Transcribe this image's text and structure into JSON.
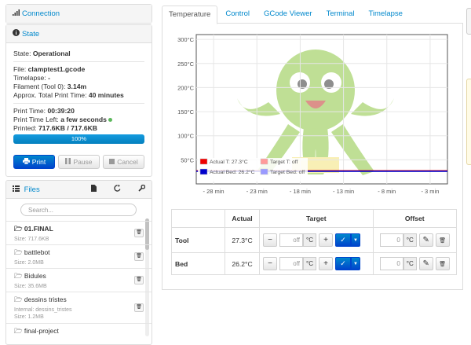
{
  "sidebar": {
    "connection": {
      "label": "Connection"
    },
    "state": {
      "label": "State",
      "state_label": "State:",
      "state_value": "Operational",
      "file_label": "File:",
      "file_value": "clamptest1.gcode",
      "timelapse_label": "Timelapse:",
      "timelapse_value": "-",
      "filament_label": "Filament (Tool 0):",
      "filament_value": "3.14m",
      "approx_label": "Approx. Total Print Time:",
      "approx_value": "40 minutes",
      "print_time_label": "Print Time:",
      "print_time_value": "00:39:20",
      "time_left_label": "Print Time Left:",
      "time_left_value": "a few seconds",
      "printed_label": "Printed:",
      "printed_value": "717.6KB / 717.6KB",
      "progress_text": "100%",
      "progress_fraction": 1.0,
      "buttons": {
        "print": "Print",
        "pause": "Pause",
        "cancel": "Cancel"
      }
    },
    "files": {
      "label": "Files",
      "search_placeholder": "Search...",
      "items": [
        {
          "name": "01.FINAL",
          "size": "Size: 717.6KB",
          "bold": true
        },
        {
          "name": "battlebot",
          "size": "Size: 2.0MB"
        },
        {
          "name": "Bidules",
          "size": "Size: 35.6MB"
        },
        {
          "name": "dessins tristes",
          "internal": "Internal: dessins_tristes",
          "size": "Size: 1.2MB"
        },
        {
          "name": "final-project",
          "size": ""
        }
      ]
    }
  },
  "tabs": [
    "Temperature",
    "Control",
    "GCode Viewer",
    "Terminal",
    "Timelapse"
  ],
  "chart_data": {
    "type": "line",
    "x_ticks": [
      "- 28 min",
      "- 23 min",
      "- 18 min",
      "- 13 min",
      "- 8 min",
      "- 3 min"
    ],
    "x_tick_minutes": [
      -28,
      -23,
      -18,
      -13,
      -8,
      -3
    ],
    "xlim_minutes": [
      -30,
      -1
    ],
    "y_ticks": [
      "300°C",
      "250°C",
      "200°C",
      "150°C",
      "100°C",
      "50°C"
    ],
    "y_tick_values": [
      300,
      250,
      200,
      150,
      100,
      50
    ],
    "ylim": [
      0,
      310
    ],
    "grid": true,
    "legend_position": "bottom-left",
    "series": [
      {
        "name": "Actual T: 27.3°C",
        "color": "#ee0000",
        "x": [
          -30,
          -1
        ],
        "values": [
          27.3,
          27.3
        ]
      },
      {
        "name": "Target T: off",
        "color": "#ff9a9a",
        "x": [],
        "values": []
      },
      {
        "name": "Actual Bed: 26.2°C",
        "color": "#0000cc",
        "x": [
          -30,
          -1
        ],
        "values": [
          26.2,
          26.2
        ]
      },
      {
        "name": "Target Bed: off",
        "color": "#9a9aff",
        "x": [],
        "values": []
      }
    ]
  },
  "temp_table": {
    "headers": [
      "",
      "Actual",
      "Target",
      "Offset"
    ],
    "rows": [
      {
        "label": "Tool",
        "actual": "27.3°C",
        "target_placeholder": "off",
        "offset_value": "0",
        "unit": "°C"
      },
      {
        "label": "Bed",
        "actual": "26.2°C",
        "target_placeholder": "off",
        "offset_value": "0",
        "unit": "°C"
      }
    ]
  },
  "colors": {
    "accent": "#0088cc",
    "primary_button": "#0044cc",
    "progress": "#149bdf",
    "status_dot": "#5cb85c"
  }
}
